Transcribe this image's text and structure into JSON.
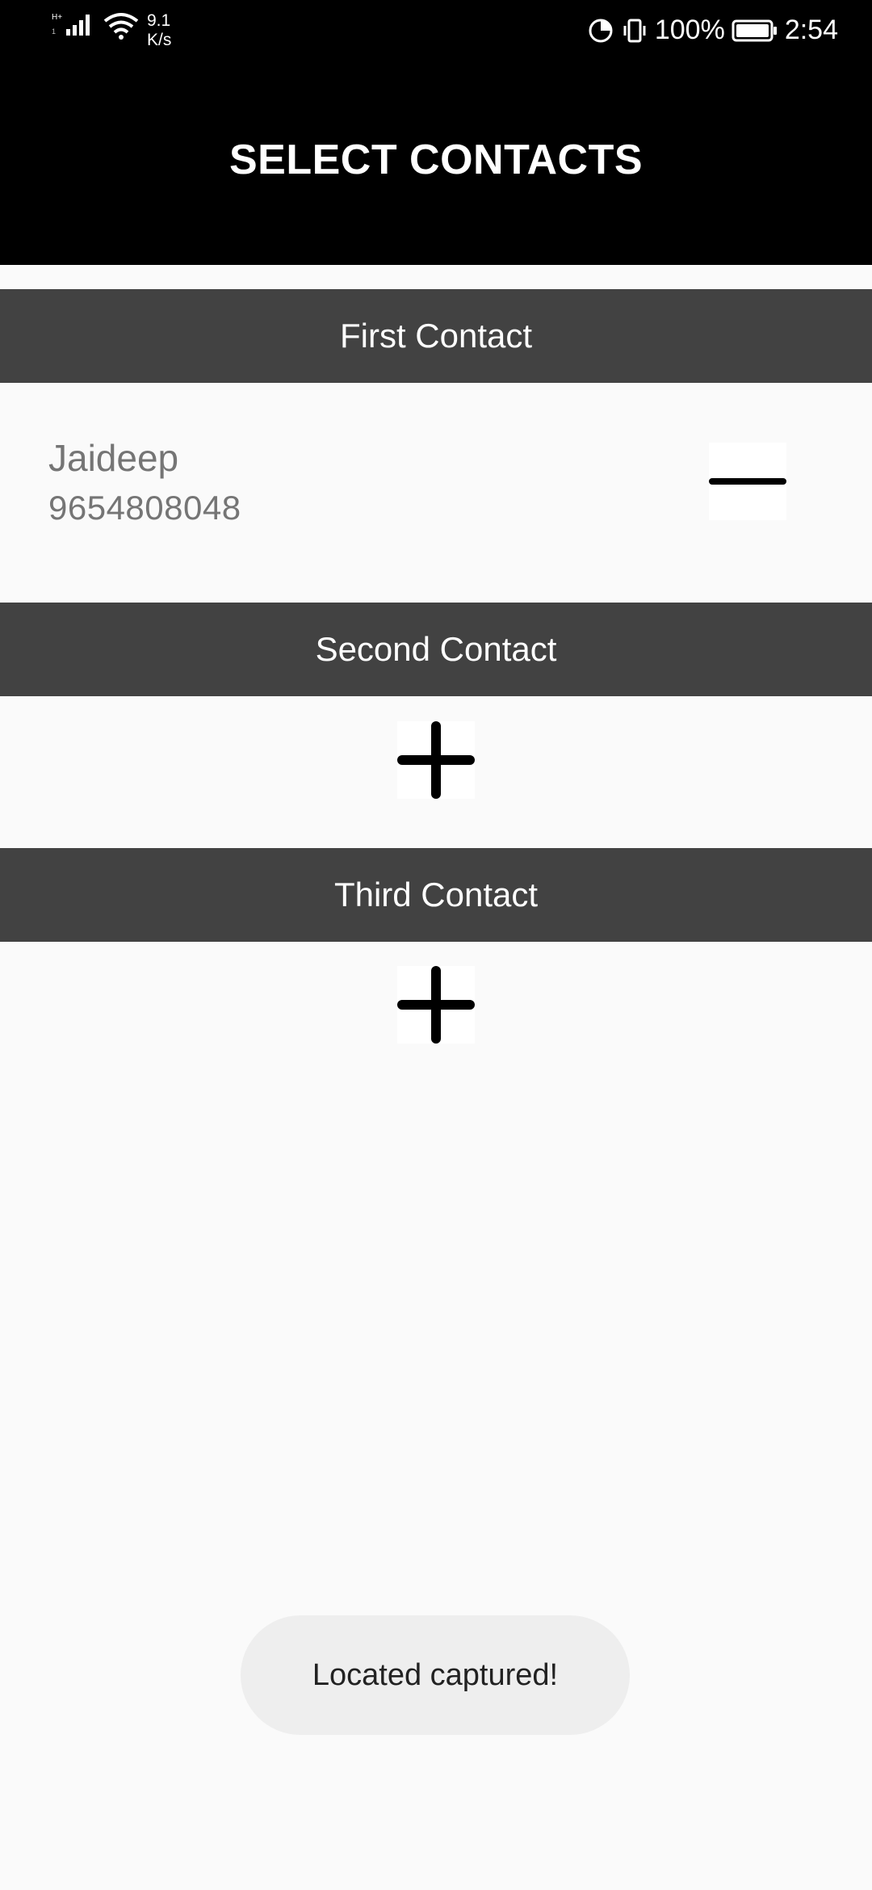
{
  "status_bar": {
    "network_speed": "9.1\nK/s",
    "speed_value": "9.1",
    "speed_unit": "K/s",
    "battery_percent": "100%",
    "time": "2:54"
  },
  "app_bar": {
    "title": "SELECT CONTACTS"
  },
  "sections": [
    {
      "header": "First Contact",
      "contact": {
        "name": "Jaideep",
        "phone": "9654808048"
      },
      "action_icon": "minus-icon"
    },
    {
      "header": "Second Contact",
      "action_icon": "plus-icon"
    },
    {
      "header": "Third Contact",
      "action_icon": "plus-icon"
    }
  ],
  "toast": {
    "message": "Located captured!"
  },
  "colors": {
    "app_bar": "#000000",
    "section_header": "#424242",
    "background": "#fafafa",
    "contact_text": "#757575",
    "toast_bg": "#eeeeee"
  }
}
